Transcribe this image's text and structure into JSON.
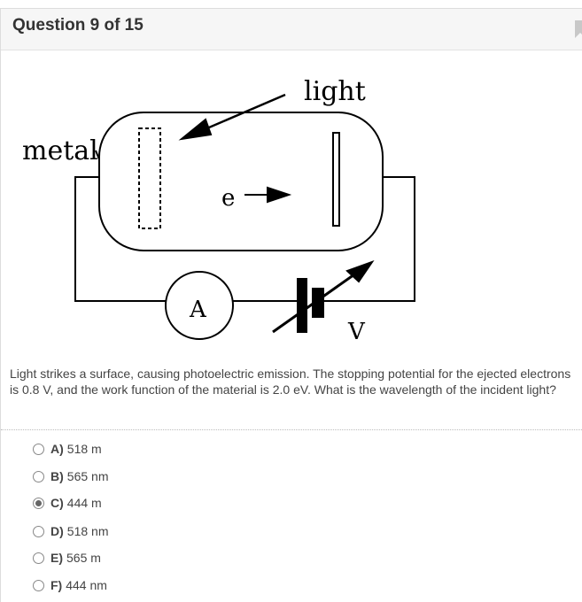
{
  "header": {
    "title": "Question 9 of 15",
    "bookmark_icon": "bookmark-icon"
  },
  "diagram": {
    "light_label": "light",
    "metal_label": "metal",
    "electron_label": "e",
    "ammeter_label": "A",
    "voltage_label": "V"
  },
  "question": {
    "text": "Light strikes a surface, causing photoelectric emission. The stopping potential for the ejected electrons is 0.8 V, and the work function of the material is 2.0 eV. What is the wavelength of the incident light?"
  },
  "options": [
    {
      "letter": "A)",
      "text": "518 m",
      "selected": false
    },
    {
      "letter": "B)",
      "text": "565 nm",
      "selected": false
    },
    {
      "letter": "C)",
      "text": "444 m",
      "selected": true
    },
    {
      "letter": "D)",
      "text": "518 nm",
      "selected": false
    },
    {
      "letter": "E)",
      "text": "565 m",
      "selected": false
    },
    {
      "letter": "F)",
      "text": "444 nm",
      "selected": false
    }
  ]
}
